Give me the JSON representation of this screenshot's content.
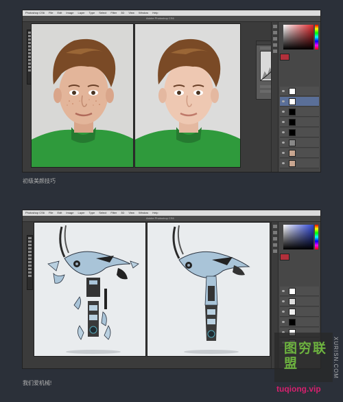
{
  "screenshot1": {
    "menubar": [
      "Photoshop CS6",
      "File",
      "Edit",
      "Image",
      "Layer",
      "Type",
      "Select",
      "Filter",
      "3D",
      "View",
      "Window",
      "Help"
    ],
    "window_title": "Adobe Photoshop CS6",
    "caption": "初级美颜技巧"
  },
  "screenshot2": {
    "menubar": [
      "Photoshop CS6",
      "File",
      "Edit",
      "Image",
      "Layer",
      "Type",
      "Select",
      "Filter",
      "3D",
      "View",
      "Window",
      "Help"
    ],
    "window_title": "Adobe Photoshop CS6",
    "caption": "我们爱机械!"
  },
  "watermark": {
    "vertical_text": "XURISN.COM",
    "logo": "图穷联盟",
    "url": "tuqiong.vip"
  },
  "colors": {
    "background": "#2b3039",
    "shirt_green": "#2f9a3c",
    "robot_blue": "#a9c4d8"
  }
}
